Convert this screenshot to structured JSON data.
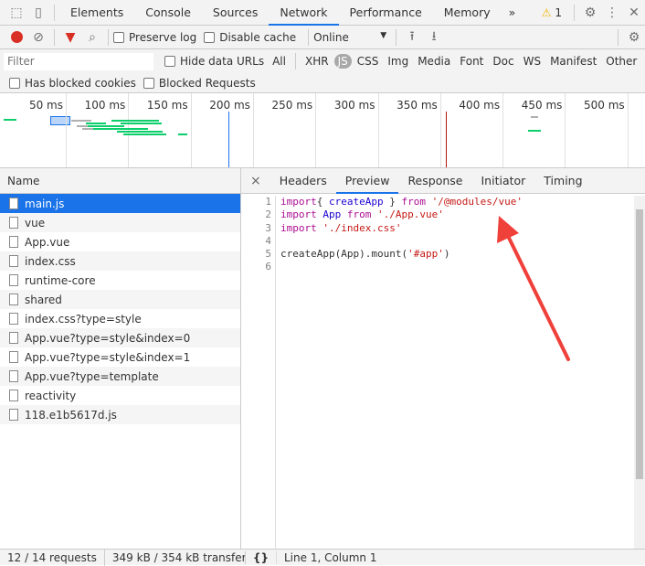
{
  "toolbar": {
    "tabs": [
      "Elements",
      "Console",
      "Sources",
      "Network",
      "Performance",
      "Memory"
    ],
    "active_tab": "Network",
    "more": "»",
    "warning_count": "1",
    "warning_icon": "⚠"
  },
  "network_bar": {
    "preserve_log": "Preserve log",
    "disable_cache": "Disable cache",
    "throttle": "Online",
    "throttle_arrow": "▼"
  },
  "filter": {
    "placeholder": "Filter",
    "hide_data_urls": "Hide data URLs",
    "types": [
      "All",
      "XHR",
      "JS",
      "CSS",
      "Img",
      "Media",
      "Font",
      "Doc",
      "WS",
      "Manifest",
      "Other"
    ],
    "active_type": "JS",
    "has_blocked_cookies": "Has blocked cookies",
    "blocked_requests": "Blocked Requests"
  },
  "overview": {
    "ticks": [
      "50 ms",
      "100 ms",
      "150 ms",
      "200 ms",
      "250 ms",
      "300 ms",
      "350 ms",
      "400 ms",
      "450 ms",
      "500 ms"
    ]
  },
  "list": {
    "header": "Name",
    "items": [
      "main.js",
      "vue",
      "App.vue",
      "index.css",
      "runtime-core",
      "shared",
      "index.css?type=style",
      "App.vue?type=style&index=0",
      "App.vue?type=style&index=1",
      "App.vue?type=template",
      "reactivity",
      "118.e1b5617d.js"
    ],
    "selected": "main.js"
  },
  "detail": {
    "close": "×",
    "tabs": [
      "Headers",
      "Preview",
      "Response",
      "Initiator",
      "Timing"
    ],
    "active_tab": "Preview",
    "line_numbers": [
      "1",
      "2",
      "3",
      "4",
      "5",
      "6"
    ],
    "code": [
      [
        [
          "kw",
          "import"
        ],
        [
          "",
          "{ "
        ],
        [
          "id",
          "createApp"
        ],
        [
          "",
          " } "
        ],
        [
          "kw",
          "from"
        ],
        [
          "",
          " "
        ],
        [
          "st",
          "'/@modules/vue'"
        ]
      ],
      [
        [
          "kw",
          "import"
        ],
        [
          "",
          " "
        ],
        [
          "id",
          "App"
        ],
        [
          "",
          " "
        ],
        [
          "kw",
          "from"
        ],
        [
          "",
          " "
        ],
        [
          "st",
          "'./App.vue'"
        ]
      ],
      [
        [
          "kw",
          "import"
        ],
        [
          "",
          " "
        ],
        [
          "st",
          "'./index.css'"
        ]
      ],
      [],
      [
        [
          "",
          "createApp(App).mount("
        ],
        [
          "st",
          "'#app'"
        ],
        [
          "",
          ")"
        ]
      ],
      []
    ]
  },
  "status": {
    "requests": "12 / 14 requests",
    "transferred": "349 kB / 354 kB transferred",
    "format": "{}",
    "cursor": "Line 1, Column 1"
  },
  "colors": {
    "accent": "#1a73e8",
    "record": "#d93025",
    "annotation_arrow": "#f0403a"
  }
}
